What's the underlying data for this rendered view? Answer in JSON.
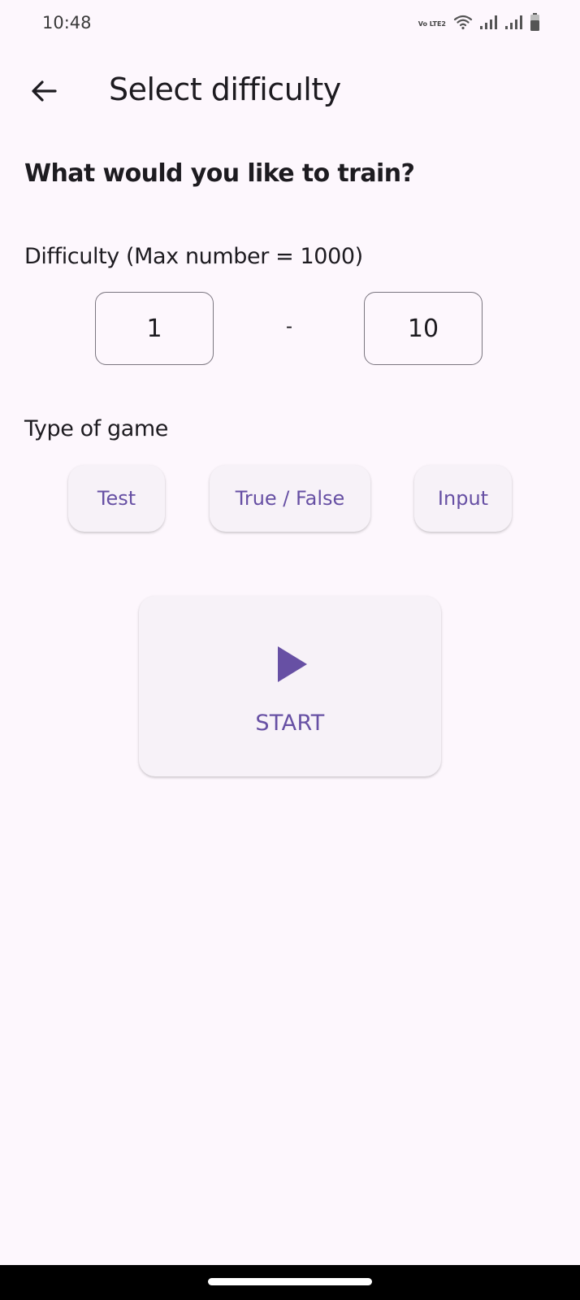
{
  "status_bar": {
    "time": "10:48",
    "network_badge": "Vo LTE2",
    "icons": [
      "volte-icon",
      "wifi-icon",
      "signal-icon",
      "signal-icon",
      "battery-icon"
    ]
  },
  "app_bar": {
    "title": "Select difficulty",
    "back_icon": "arrow-left-icon"
  },
  "main": {
    "question": "What would you like to train?",
    "difficulty": {
      "label": "Difficulty (Max number = 1000)",
      "min": "1",
      "separator": "-",
      "max": "10"
    },
    "game_type": {
      "label": "Type of game",
      "options": [
        "Test",
        "True / False",
        "Input"
      ]
    },
    "start_button": {
      "icon": "play-icon",
      "label": "START"
    }
  },
  "colors": {
    "accent": "#6750a4",
    "background": "#fdf7fd",
    "surface": "#f7f2f8",
    "text": "#1d1b20"
  }
}
